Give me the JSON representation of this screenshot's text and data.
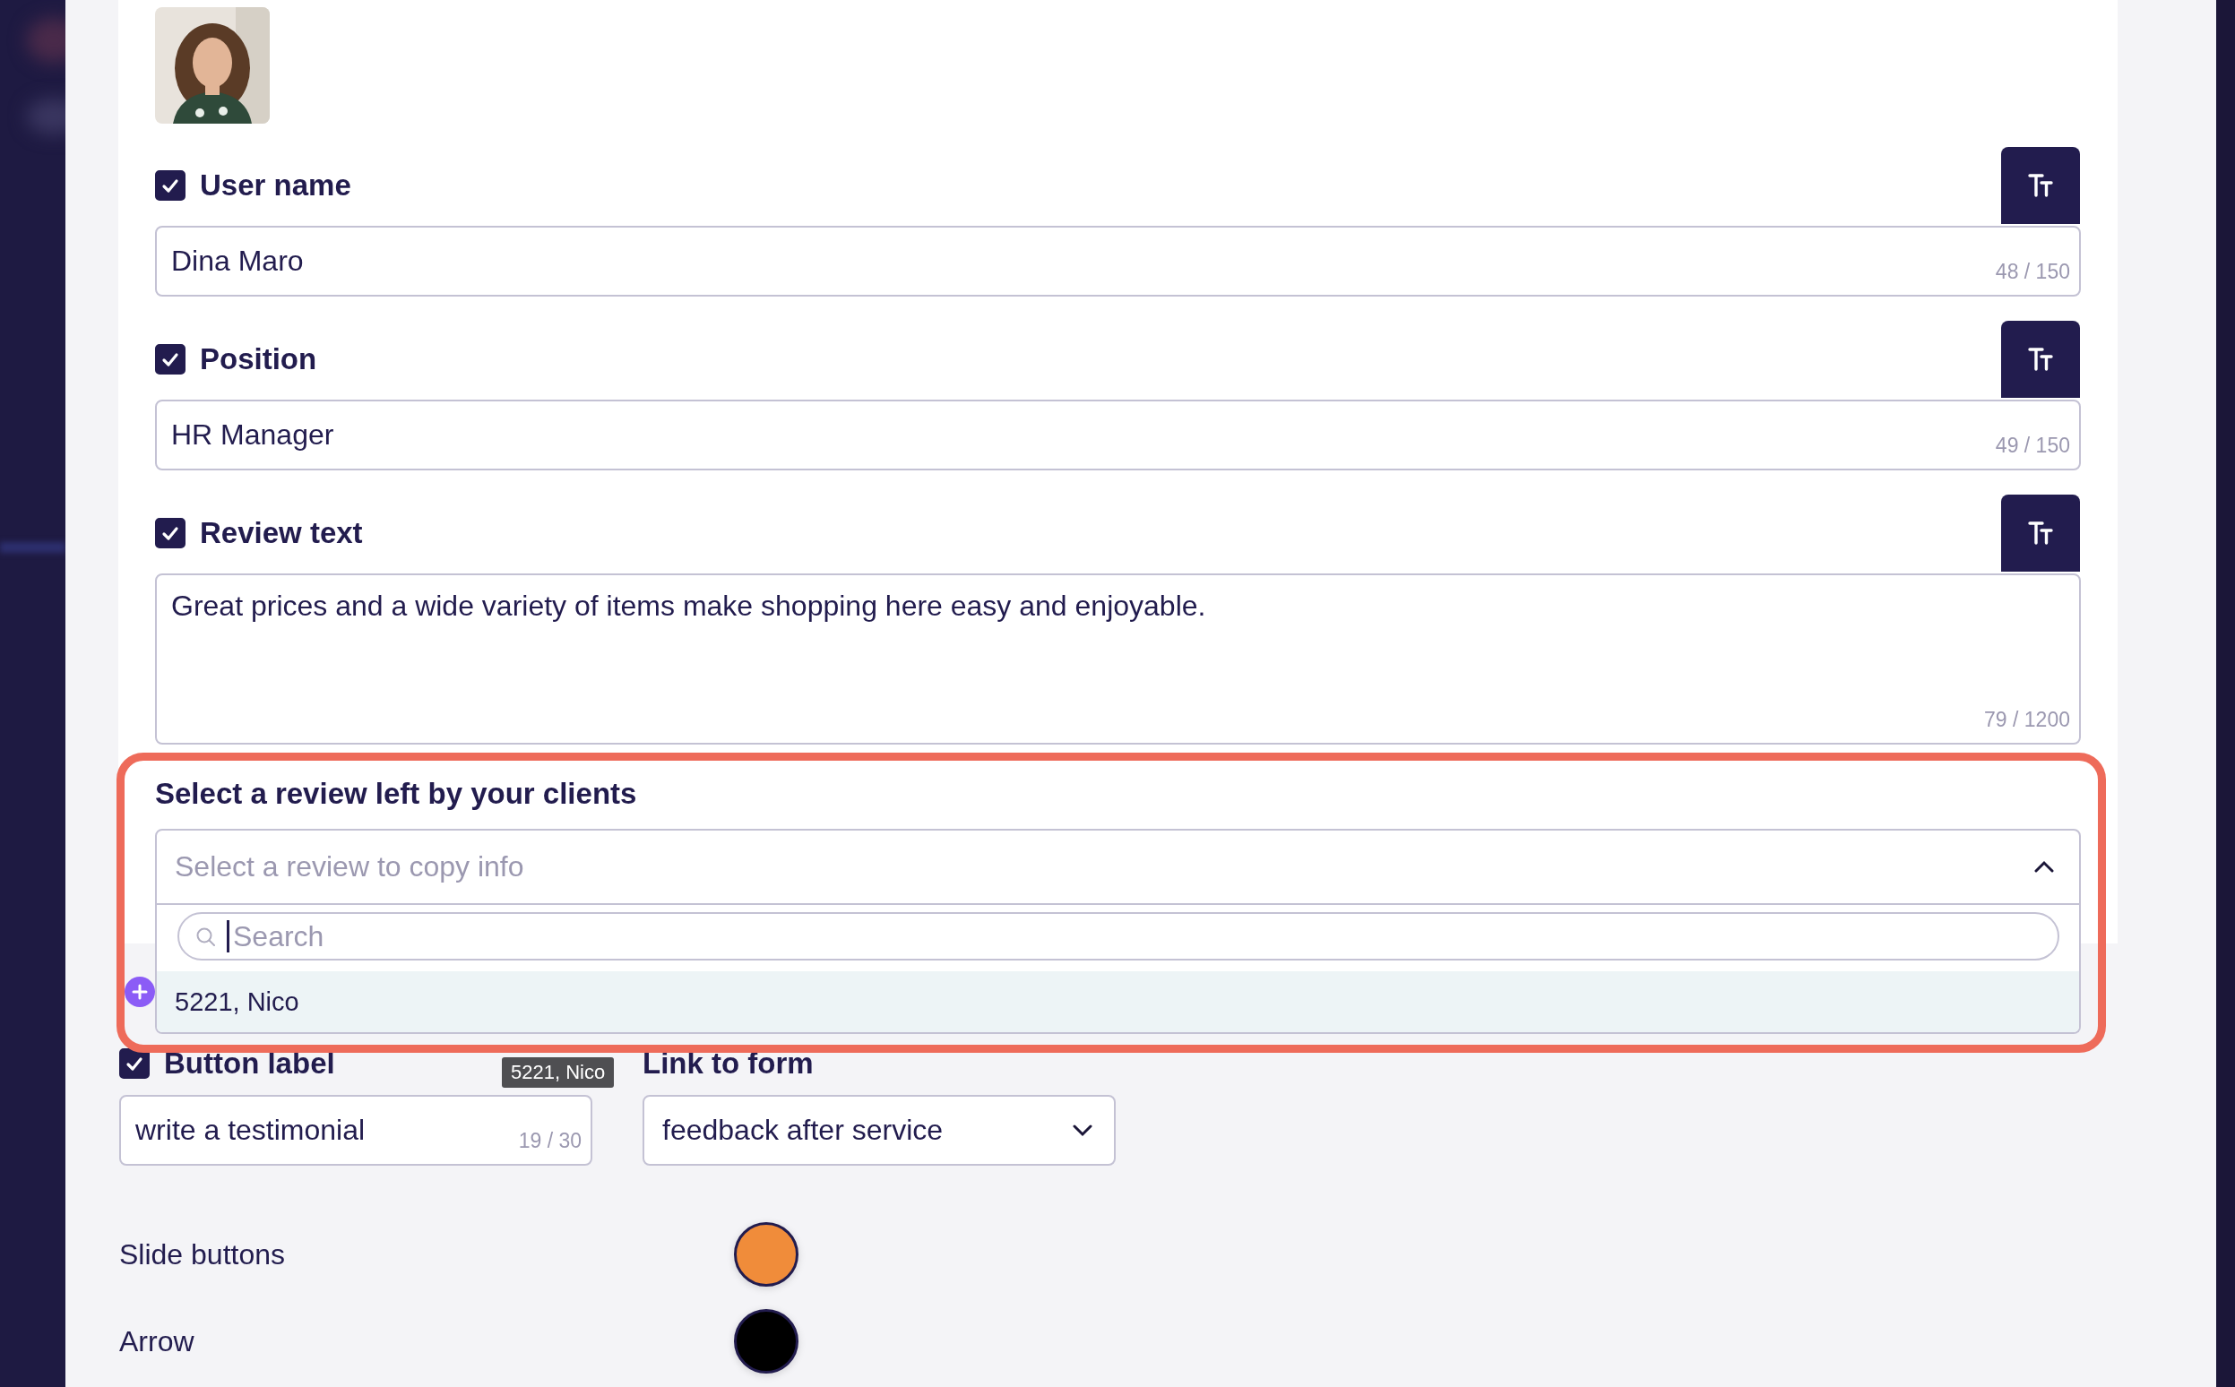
{
  "fields": [
    {
      "kind": "input",
      "label": "User name",
      "checked": true,
      "value": "Dina Maro",
      "counter": "48 / 150"
    },
    {
      "kind": "input",
      "label": "Position",
      "checked": true,
      "value": "HR Manager",
      "counter": "49 / 150"
    },
    {
      "kind": "textarea",
      "label": "Review text",
      "checked": true,
      "value": "Great prices and a wide variety of items make shopping here easy and enjoyable.",
      "counter": "79 / 1200"
    }
  ],
  "review_select": {
    "label": "Select a review left by your clients",
    "placeholder": "Select a review to copy info",
    "expanded": true,
    "search": {
      "placeholder": "Search"
    },
    "options": [
      {
        "label": "5221, Nico",
        "highlighted": true
      }
    ]
  },
  "tooltip": {
    "text": "5221, Nico"
  },
  "button_label": {
    "label": "Button label",
    "checked": true,
    "value": "write a testimonial",
    "counter": "19 / 30"
  },
  "link_to_form": {
    "label": "Link to form",
    "value": "feedback after service"
  },
  "colors": [
    {
      "label": "Slide buttons",
      "color": "#f08c3a"
    },
    {
      "label": "Arrow",
      "color": "#000000"
    }
  ]
}
